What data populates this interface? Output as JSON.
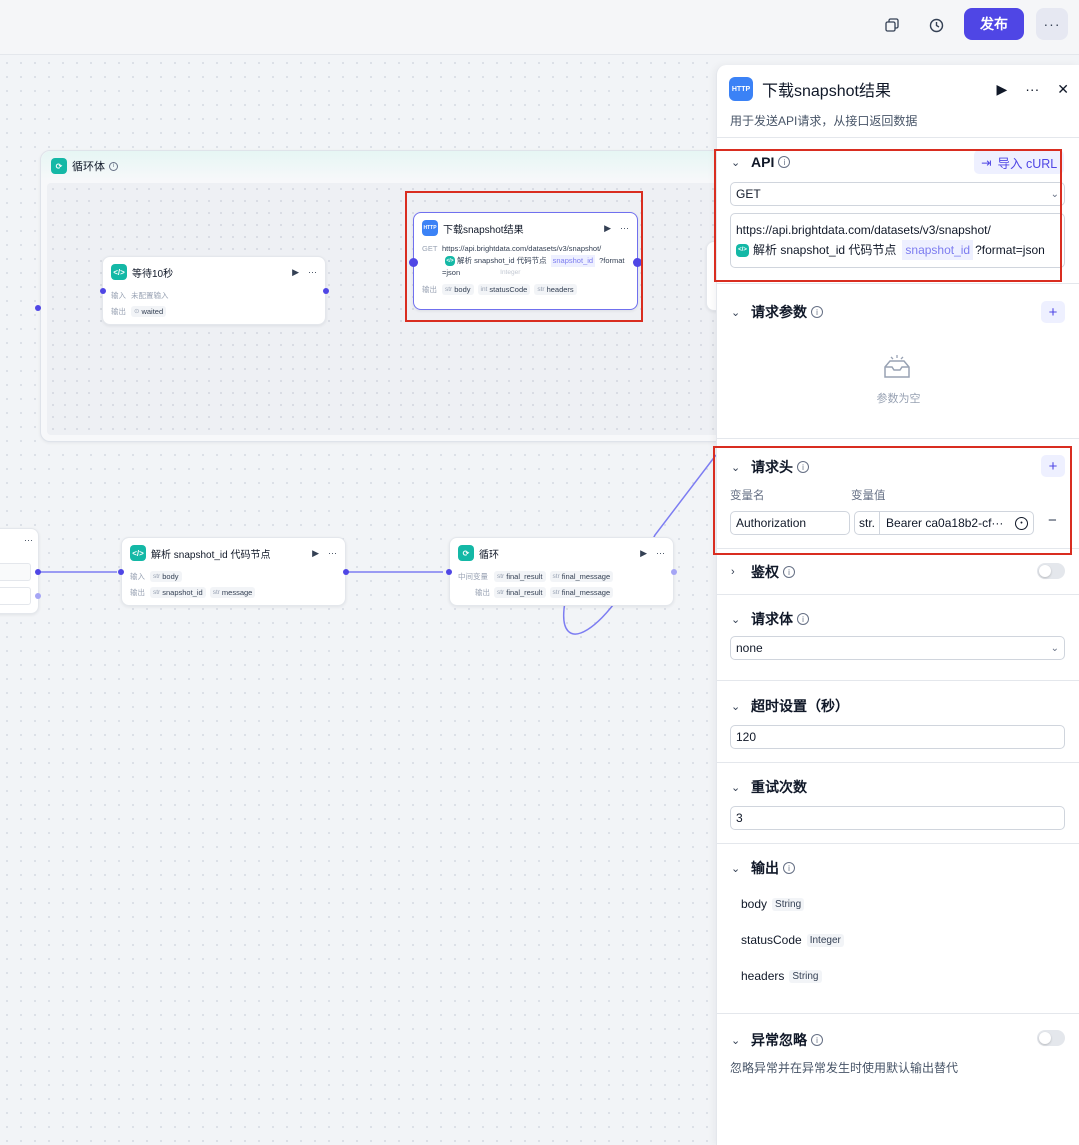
{
  "topbar": {
    "copy_icon": "copy-icon",
    "history_icon": "history-icon",
    "publish_label": "发布",
    "more_label": "···"
  },
  "canvas": {
    "loop_body": {
      "title": "循环体"
    },
    "wait_node": {
      "title": "等待10秒",
      "input_label": "输入",
      "input_value": "未配置输入",
      "output_label": "输出",
      "output_value": "waited"
    },
    "http_node": {
      "title": "下载snapshot结果",
      "method": "GET",
      "url": "https://api.brightdata.com/datasets/v3/snapshot/",
      "ref_node": "解析 snapshot_id 代码节点",
      "ref_var": "snapshot_id",
      "ghost_type": "Integer",
      "suffix1": "?format",
      "suffix2": "=json",
      "output_label": "输出",
      "outputs": [
        {
          "type": "str",
          "name": "body"
        },
        {
          "type": "int",
          "name": "statusCode"
        },
        {
          "type": "str",
          "name": "headers"
        }
      ]
    },
    "parse_node": {
      "title": "解析 snapshot_id 代码节点",
      "input_label": "输入",
      "input": {
        "type": "str",
        "name": "body"
      },
      "output_label": "输出",
      "outputs": [
        {
          "type": "str",
          "name": "snapshot_id"
        },
        {
          "type": "str",
          "name": "message"
        }
      ]
    },
    "loop_node": {
      "title": "循环",
      "mid_label": "中间变量",
      "mid_vars": [
        {
          "type": "str",
          "name": "final_result"
        },
        {
          "type": "str",
          "name": "final_message"
        }
      ],
      "output_label": "输出",
      "outputs": [
        {
          "type": "str",
          "name": "final_result"
        },
        {
          "type": "str",
          "name": "final_message"
        }
      ]
    }
  },
  "panel": {
    "title": "下载snapshot结果",
    "http_badge": "HTTP",
    "description": "用于发送API请求，从接口返回数据",
    "api": {
      "title": "API",
      "import_label": "导入 cURL",
      "method": "GET",
      "url_line": "https://api.brightdata.com/datasets/v3/snapshot/",
      "ref_node": "解析 snapshot_id 代码节点",
      "ref_var": "snapshot_id",
      "url_suffix": "?format=json"
    },
    "params": {
      "title": "请求参数",
      "empty_text": "参数为空"
    },
    "headers": {
      "title": "请求头",
      "col_name": "变量名",
      "col_value": "变量值",
      "name_value": "Authorization",
      "value_type": "str.",
      "value_text": "Bearer ca0a18b2-cf···"
    },
    "auth": {
      "title": "鉴权"
    },
    "body": {
      "title": "请求体",
      "value": "none"
    },
    "timeout": {
      "title": "超时设置（秒）",
      "value": "120"
    },
    "retry": {
      "title": "重试次数",
      "value": "3"
    },
    "output": {
      "title": "输出",
      "items": [
        {
          "name": "body",
          "type": "String"
        },
        {
          "name": "statusCode",
          "type": "Integer"
        },
        {
          "name": "headers",
          "type": "String"
        }
      ]
    },
    "ignore_error": {
      "title": "异常忽略",
      "description": "忽略异常并在异常发生时使用默认输出替代"
    }
  }
}
